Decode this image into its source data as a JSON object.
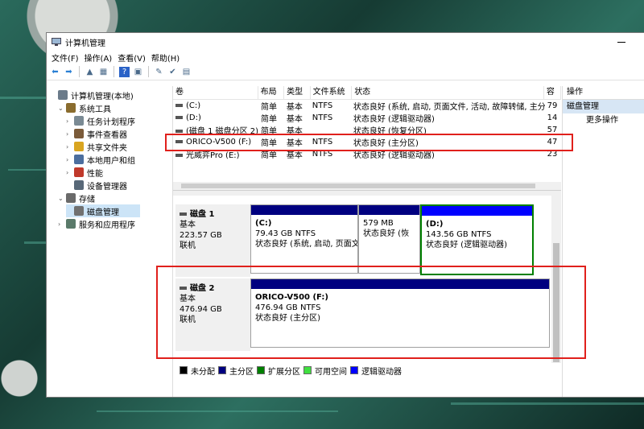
{
  "window": {
    "title": "计算机管理"
  },
  "menu": [
    "文件(F)",
    "操作(A)",
    "查看(V)",
    "帮助(H)"
  ],
  "toolbar": [
    {
      "icon": "back-arrow-icon",
      "glyph": "⬅"
    },
    {
      "icon": "forward-arrow-icon",
      "glyph": "➡"
    },
    {
      "icon": "up-folder-icon",
      "glyph": "▲"
    },
    {
      "icon": "show-hide-tree-icon",
      "glyph": "▦"
    },
    {
      "icon": "help-icon",
      "glyph": "?"
    },
    {
      "icon": "console-icon",
      "glyph": "▣"
    },
    {
      "icon": "connect-icon",
      "glyph": "✎"
    },
    {
      "icon": "check-icon",
      "glyph": "✔"
    },
    {
      "icon": "properties-icon",
      "glyph": "▤"
    }
  ],
  "tree": [
    {
      "label": "计算机管理(本地)",
      "arrow": "",
      "icon": "computer-management-icon",
      "color": "#6b7b8a",
      "indent": 0
    },
    {
      "label": "系统工具",
      "arrow": "⌄",
      "icon": "system-tools-icon",
      "color": "#8a6c2e",
      "indent": 1
    },
    {
      "label": "任务计划程序",
      "arrow": "›",
      "icon": "task-scheduler-icon",
      "color": "#7a8a94",
      "indent": 2
    },
    {
      "label": "事件查看器",
      "arrow": "›",
      "icon": "event-viewer-icon",
      "color": "#7b5b3a",
      "indent": 2
    },
    {
      "label": "共享文件夹",
      "arrow": "›",
      "icon": "shared-folders-icon",
      "color": "#d9a520",
      "indent": 2
    },
    {
      "label": "本地用户和组",
      "arrow": "›",
      "icon": "local-users-icon",
      "color": "#4c6e9e",
      "indent": 2
    },
    {
      "label": "性能",
      "arrow": "›",
      "icon": "performance-icon",
      "color": "#c0392b",
      "indent": 2
    },
    {
      "label": "设备管理器",
      "arrow": "",
      "icon": "device-manager-icon",
      "color": "#586878",
      "indent": 2
    },
    {
      "label": "存储",
      "arrow": "⌄",
      "icon": "storage-icon",
      "color": "#6a6a6a",
      "indent": 1
    },
    {
      "label": "磁盘管理",
      "arrow": "",
      "icon": "disk-management-icon",
      "color": "#707070",
      "indent": 2
    },
    {
      "label": "服务和应用程序",
      "arrow": "›",
      "icon": "services-apps-icon",
      "color": "#5a7a6a",
      "indent": 1
    }
  ],
  "volume_columns": [
    "卷",
    "布局",
    "类型",
    "文件系统",
    "状态",
    "容"
  ],
  "volumes": [
    {
      "name": "(C:)",
      "layout": "简单",
      "type": "基本",
      "fs": "NTFS",
      "status": "状态良好 (系统, 启动, 页面文件, 活动, 故障转储, 主分区)",
      "cap": "79"
    },
    {
      "name": "(D:)",
      "layout": "简单",
      "type": "基本",
      "fs": "NTFS",
      "status": "状态良好 (逻辑驱动器)",
      "cap": "14"
    },
    {
      "name": "(磁盘 1 磁盘分区 2)",
      "layout": "简单",
      "type": "基本",
      "fs": "",
      "status": "状态良好 (恢复分区)",
      "cap": "57"
    },
    {
      "name": "ORICO-V500 (F:)",
      "layout": "简单",
      "type": "基本",
      "fs": "NTFS",
      "status": "状态良好 (主分区)",
      "cap": "47"
    },
    {
      "name": "光威弈Pro (E:)",
      "layout": "简单",
      "type": "基本",
      "fs": "NTFS",
      "status": "状态良好 (逻辑驱动器)",
      "cap": "23"
    }
  ],
  "disks": [
    {
      "name": "磁盘 1",
      "kind": "基本",
      "size": "223.57 GB",
      "state": "联机",
      "partitions": [
        {
          "title": "(C:)",
          "line1": "79.43 GB NTFS",
          "line2": "状态良好 (系统, 启动, 页面文",
          "kind": "primary"
        },
        {
          "title": "",
          "line1": "579 MB",
          "line2": "状态良好 (恢",
          "kind": "primary"
        },
        {
          "title": "(D:)",
          "line1": "143.56 GB NTFS",
          "line2": "状态良好 (逻辑驱动器)",
          "kind": "logical"
        }
      ]
    },
    {
      "name": "磁盘 2",
      "kind": "基本",
      "size": "476.94 GB",
      "state": "联机",
      "partitions": [
        {
          "title": "ORICO-V500  (F:)",
          "line1": "476.94 GB NTFS",
          "line2": "状态良好 (主分区)",
          "kind": "primary"
        }
      ]
    }
  ],
  "legend": [
    {
      "label": "未分配",
      "color": "#000000"
    },
    {
      "label": "主分区",
      "color": "#000080"
    },
    {
      "label": "扩展分区",
      "color": "#008000"
    },
    {
      "label": "可用空间",
      "color": "#40e040"
    },
    {
      "label": "逻辑驱动器",
      "color": "#0000ff"
    }
  ],
  "actions": {
    "header": "操作",
    "subheader": "磁盘管理",
    "more": "更多操作"
  },
  "colors": {
    "highlight": "#e0201c",
    "selection": "#cce4f7",
    "extended": "#008000"
  }
}
